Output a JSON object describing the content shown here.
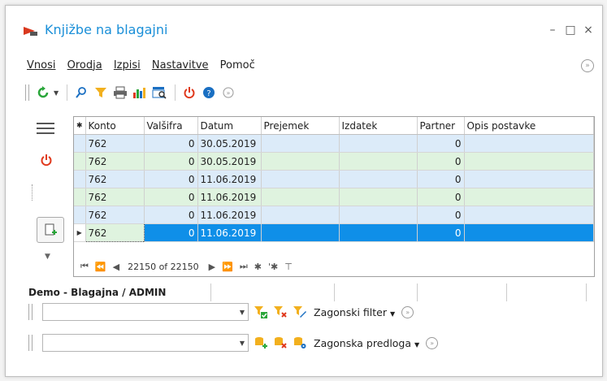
{
  "window": {
    "title": "Knjižbe na blagajni",
    "minimize": "–",
    "maximize": "□",
    "close": "×"
  },
  "menu": {
    "items": [
      "Vnosi",
      "Orodja",
      "Izpisi",
      "Nastavitve",
      "Pomoč"
    ]
  },
  "toolbar": {
    "icons": [
      "refresh-icon",
      "search-icon",
      "filter-icon",
      "print-icon",
      "chart-icon",
      "report-icon",
      "power-icon",
      "help-icon",
      "overflow-icon"
    ]
  },
  "grid": {
    "columns": [
      "Konto",
      "Valšifra",
      "Datum",
      "Prejemek",
      "Izdatek",
      "Partner",
      "Opis postavke"
    ],
    "rows": [
      {
        "konto": "762",
        "valsifra": "0",
        "datum": "30.05.2019",
        "prejemek": "",
        "izdatek": "",
        "partner": "0",
        "opis": ""
      },
      {
        "konto": "762",
        "valsifra": "0",
        "datum": "30.05.2019",
        "prejemek": "",
        "izdatek": "",
        "partner": "0",
        "opis": ""
      },
      {
        "konto": "762",
        "valsifra": "0",
        "datum": "11.06.2019",
        "prejemek": "",
        "izdatek": "",
        "partner": "0",
        "opis": ""
      },
      {
        "konto": "762",
        "valsifra": "0",
        "datum": "11.06.2019",
        "prejemek": "",
        "izdatek": "",
        "partner": "0",
        "opis": ""
      },
      {
        "konto": "762",
        "valsifra": "0",
        "datum": "11.06.2019",
        "prejemek": "",
        "izdatek": "",
        "partner": "0",
        "opis": ""
      },
      {
        "konto": "762",
        "valsifra": "0",
        "datum": "11.06.2019",
        "prejemek": "",
        "izdatek": "",
        "partner": "0",
        "opis": ""
      }
    ],
    "navigator": "22150 of 22150"
  },
  "status": {
    "context": "Demo - Blagajna / ADMIN"
  },
  "filters": {
    "filter_label": "Zagonski filter",
    "filter_value": "",
    "template_label": "Zagonska predloga",
    "template_value": ""
  },
  "colors": {
    "accent": "#1a8fd8",
    "row_blue": "#dcebf9",
    "row_green": "#dff3df",
    "selected": "#0f8fe8",
    "power_red": "#e03a1e"
  }
}
